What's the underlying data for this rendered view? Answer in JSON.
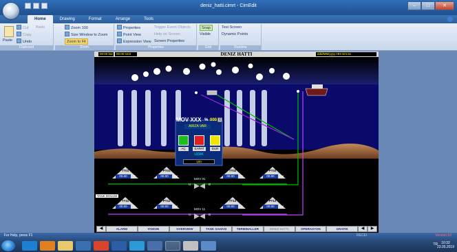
{
  "window": {
    "title": "deniz_hatti.cimrt - CimEdit",
    "controls": [
      "–",
      "□",
      "✕"
    ]
  },
  "ribbon": {
    "tabs": [
      "Home",
      "Drawing",
      "Format",
      "Arrange",
      "Tools"
    ],
    "active_tab": "Home",
    "clipboard": {
      "paste": "Paste",
      "cut": "Cut",
      "copy": "Copy",
      "undo": "Undo",
      "redo": "Redo",
      "label": "Clipboard"
    },
    "zoom": {
      "zoom": "Zoom 100",
      "size_window": "Size Window to Zoom",
      "zoom_fit": "Zoom to Fit",
      "label": "Zoom"
    },
    "properties": {
      "properties": "Properties",
      "point_view": "Point View",
      "expression_view": "Expression View",
      "trigger": "Trigger Event Objects",
      "help": "Help on Screen",
      "screen_properties": "Screen Properties",
      "label": "Properties"
    },
    "grid": {
      "snap": "Snap",
      "visible": "Visible",
      "label": "Grid"
    },
    "runtime": {
      "test_screen": "Test Screen",
      "dynamic_points": "Dynamic Points",
      "label": "Runtime"
    }
  },
  "hmi": {
    "title": "DENIZ HATTI",
    "left_field_1": "00:00  bar",
    "left_field_2": "00.00 sm3",
    "right_field": "ddd/MM/yyyy HH:mm:ss",
    "mov_panel": {
      "title": "MOV XXX",
      "pct_symbol": "%",
      "value": "000",
      "close_x": "X",
      "status": "ARIZA VAR",
      "btn_open": "AÇ",
      "btn_close": "KAPAT",
      "btn_stop": "DUR",
      "mode": "UZAK",
      "output": "100"
    },
    "upper_row": [
      {
        "name": "TT01",
        "value": "00.00",
        "unit": "°C"
      },
      {
        "name": "PT01",
        "value": "00.00",
        "unit": "bar"
      },
      {
        "name": "TT02",
        "value": "00.00",
        "unit": "°C"
      },
      {
        "name": "PT02",
        "value": "00.00",
        "unit": "bar"
      }
    ],
    "lower_row": [
      {
        "name": "TT11",
        "value": "00.00",
        "unit": "°C"
      },
      {
        "name": "PT11",
        "value": "00.00",
        "unit": "bar"
      },
      {
        "name": "TT12",
        "value": "00.00",
        "unit": "°C"
      },
      {
        "name": "PT12",
        "value": "00.00",
        "unit": "bar"
      }
    ],
    "mov_upper": {
      "label": "MOV 01",
      "u": "U",
      "b": "B"
    },
    "mov_lower": {
      "label": "MOV 11",
      "u": "U",
      "b": "B"
    },
    "tank_label": "TANK DOLUM",
    "nav": [
      "ALARM",
      "YANGIN",
      "OVERVIEW",
      "TANK SAHASI",
      "TERMINALLER",
      "DENIZ HATTI",
      "OPERASYON",
      "GRAFIK"
    ],
    "nav_disabled": "DENIZ HATTI"
  },
  "statusbar": {
    "help": "For Help, press F1",
    "mid": "RECEI",
    "version": "Version 10"
  },
  "taskbar": {
    "tray": "TR",
    "time": "10:32",
    "date": "23.05.2019"
  }
}
